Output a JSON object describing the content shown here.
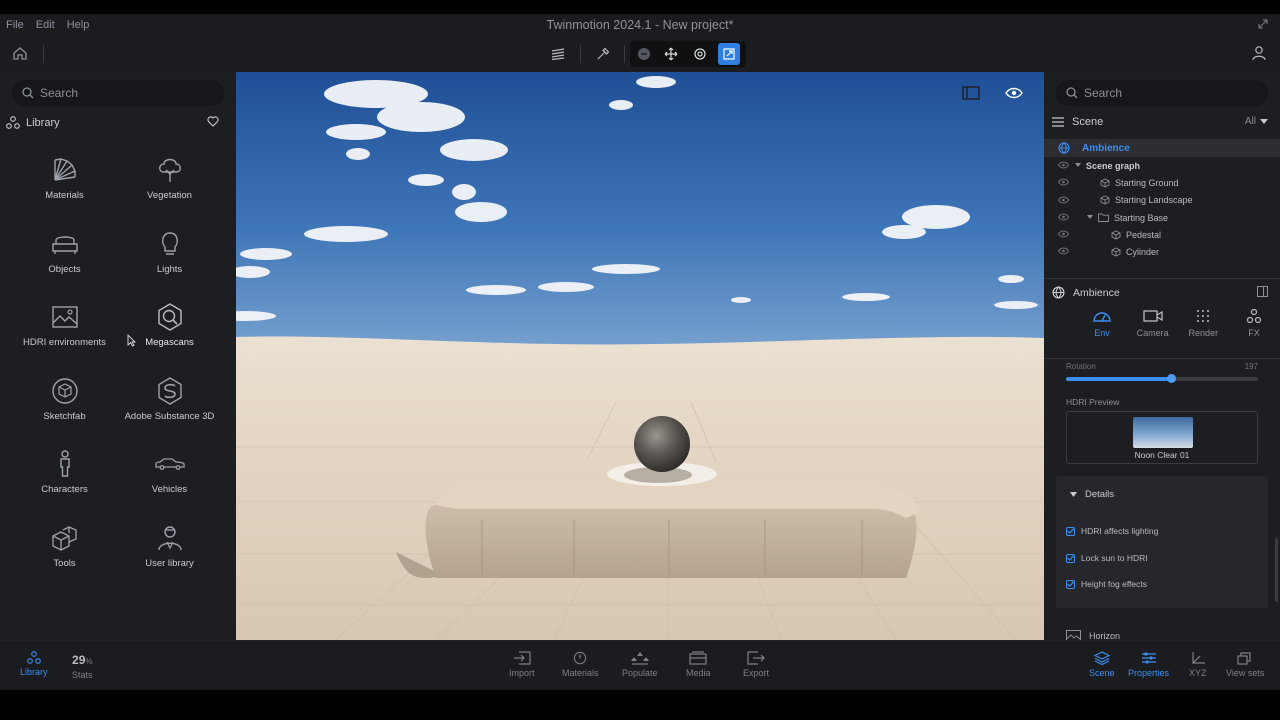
{
  "window": {
    "title": "Twinmotion 2024.1 - New project*"
  },
  "menu": {
    "file": "File",
    "edit": "Edit",
    "help": "Help"
  },
  "left": {
    "search_placeholder": "Search",
    "library_label": "Library",
    "tiles": {
      "materials": "Materials",
      "vegetation": "Vegetation",
      "objects": "Objects",
      "lights": "Lights",
      "hdri": "HDRI environments",
      "megascans": "Megascans",
      "sketchfab": "Sketchfab",
      "substance": "Adobe Substance 3D",
      "characters": "Characters",
      "vehicles": "Vehicles",
      "tools": "Tools",
      "user_library": "User library"
    }
  },
  "right": {
    "search_placeholder": "Search",
    "scene_label": "Scene",
    "filter_label": "All",
    "tree": {
      "ambience": "Ambience",
      "scene_graph": "Scene graph",
      "starting_ground": "Starting Ground",
      "starting_landscape": "Starting Landscape",
      "starting_base": "Starting Base",
      "pedestal": "Pedestal",
      "cylinder": "Cylinder"
    },
    "props": {
      "title": "Ambience",
      "tabs": {
        "env": "Env",
        "camera": "Camera",
        "render": "Render",
        "fx": "FX"
      },
      "rotation_label": "Rotation",
      "rotation_value": "197",
      "rotation_fraction": 0.55,
      "hdri_preview_label": "HDRI Preview",
      "hdri_name": "Noon Clear 01",
      "details_label": "Details",
      "checks": {
        "c1": "HDRI affects lighting",
        "c2": "Lock sun to HDRI",
        "c3": "Height fog effects"
      },
      "horizon_label": "Horizon"
    }
  },
  "bottom": {
    "library": "Library",
    "stats_value": "29",
    "stats_unit": "%",
    "stats": "Stats",
    "import": "Import",
    "materials": "Materials",
    "populate": "Populate",
    "media": "Media",
    "export": "Export",
    "scene": "Scene",
    "properties": "Properties",
    "xyz": "XYZ",
    "view_sets": "View sets"
  },
  "colors": {
    "accent": "#3c8ff0",
    "panel": "#1d1e22",
    "bar": "#1b1c20"
  }
}
